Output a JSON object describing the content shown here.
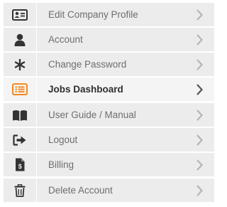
{
  "menu": {
    "items": [
      {
        "label": "Edit Company Profile",
        "icon": "id-card-icon",
        "active": false
      },
      {
        "label": "Account",
        "icon": "user-icon",
        "active": false
      },
      {
        "label": "Change Password",
        "icon": "asterisk-icon",
        "active": false
      },
      {
        "label": "Jobs Dashboard",
        "icon": "list-icon",
        "active": true
      },
      {
        "label": "User Guide / Manual",
        "icon": "book-icon",
        "active": false
      },
      {
        "label": "Logout",
        "icon": "sign-out-icon",
        "active": false
      },
      {
        "label": "Billing",
        "icon": "invoice-icon",
        "active": false
      },
      {
        "label": "Delete Account",
        "icon": "trash-icon",
        "active": false
      }
    ]
  },
  "colors": {
    "row_background": "#ececec",
    "active_row_background": "#f4f4f4",
    "icon": "#333333",
    "active_icon": "#f08a24",
    "label": "#6e6e6e",
    "active_label": "#2f2f2f",
    "chevron": "#b5b5b5",
    "active_chevron": "#555555"
  }
}
